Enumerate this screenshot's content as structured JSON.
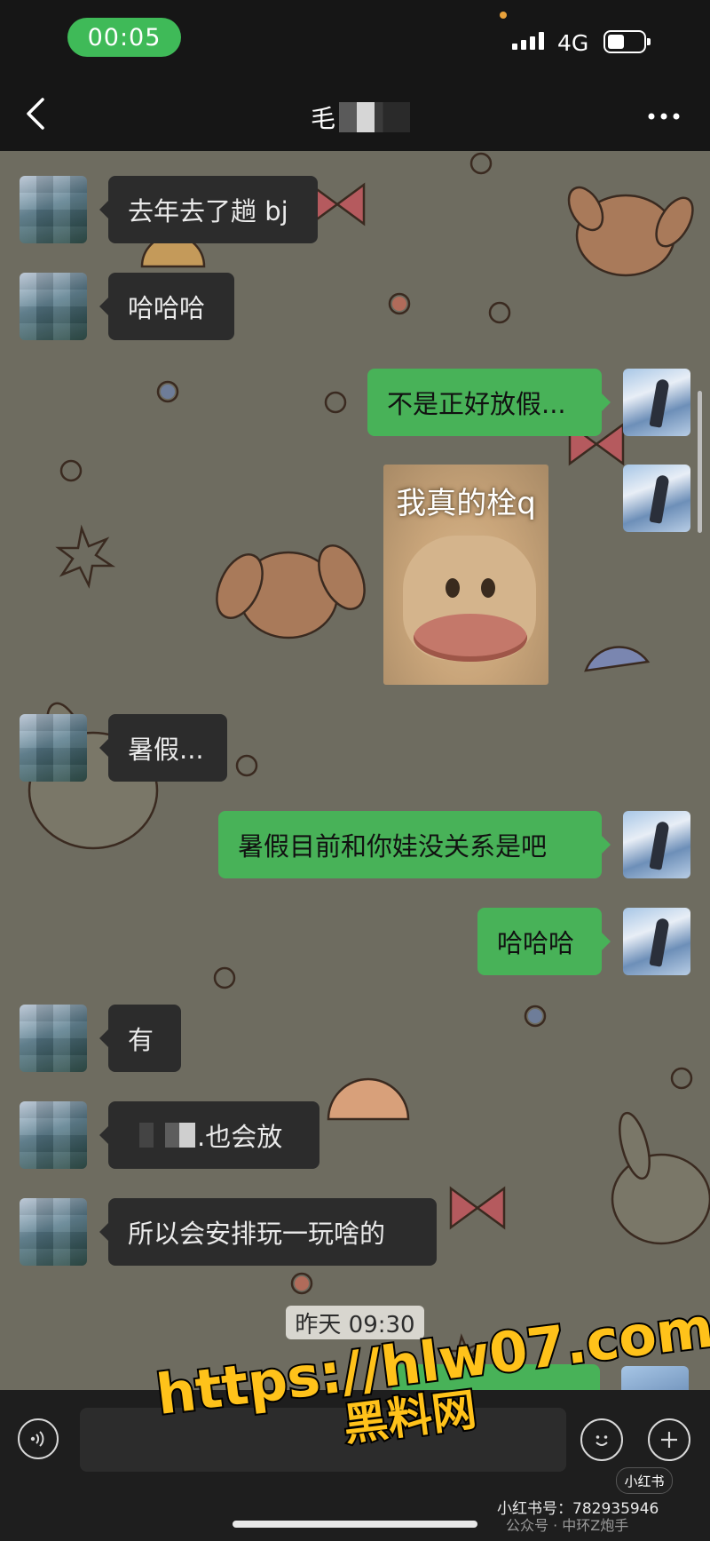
{
  "status_bar": {
    "time": "00:05",
    "network": "4G",
    "icons": [
      "signal-bars-icon",
      "battery-icon"
    ]
  },
  "nav": {
    "back_icon": "chevron-left-icon",
    "title": "毛",
    "more_icon": "ellipsis-icon"
  },
  "messages": [
    {
      "side": "in",
      "text": "去年去了趟 bj"
    },
    {
      "side": "in",
      "text": "哈哈哈"
    },
    {
      "side": "out",
      "text": "不是正好放假..."
    },
    {
      "side": "out",
      "type": "sticker",
      "caption": "我真的栓q"
    },
    {
      "side": "in",
      "text": "暑假..."
    },
    {
      "side": "out",
      "text": "暑假目前和你娃没关系是吧"
    },
    {
      "side": "out",
      "text": "哈哈哈"
    },
    {
      "side": "in",
      "text": "有"
    },
    {
      "side": "in",
      "text": ".也会放"
    },
    {
      "side": "in",
      "text": "所以会安排玩一玩啥的"
    }
  ],
  "timestamp": "昨天 09:30",
  "input_bar": {
    "voice_icon": "voice-icon",
    "emoji_icon": "smiley-icon",
    "plus_icon": "plus-circle-icon"
  },
  "watermark": {
    "url": "https://hlw07.com",
    "site": "黑料网"
  },
  "footer": {
    "badge": "小红书",
    "id_line": "小红书号：782935946",
    "gzh_line": "公众号 · 中环Z炮手"
  },
  "colors": {
    "green_bubble": "#48b258",
    "dark_bubble": "#2c2c2c",
    "chat_bg": "#6e6c60",
    "time_pill": "#3fba58"
  }
}
